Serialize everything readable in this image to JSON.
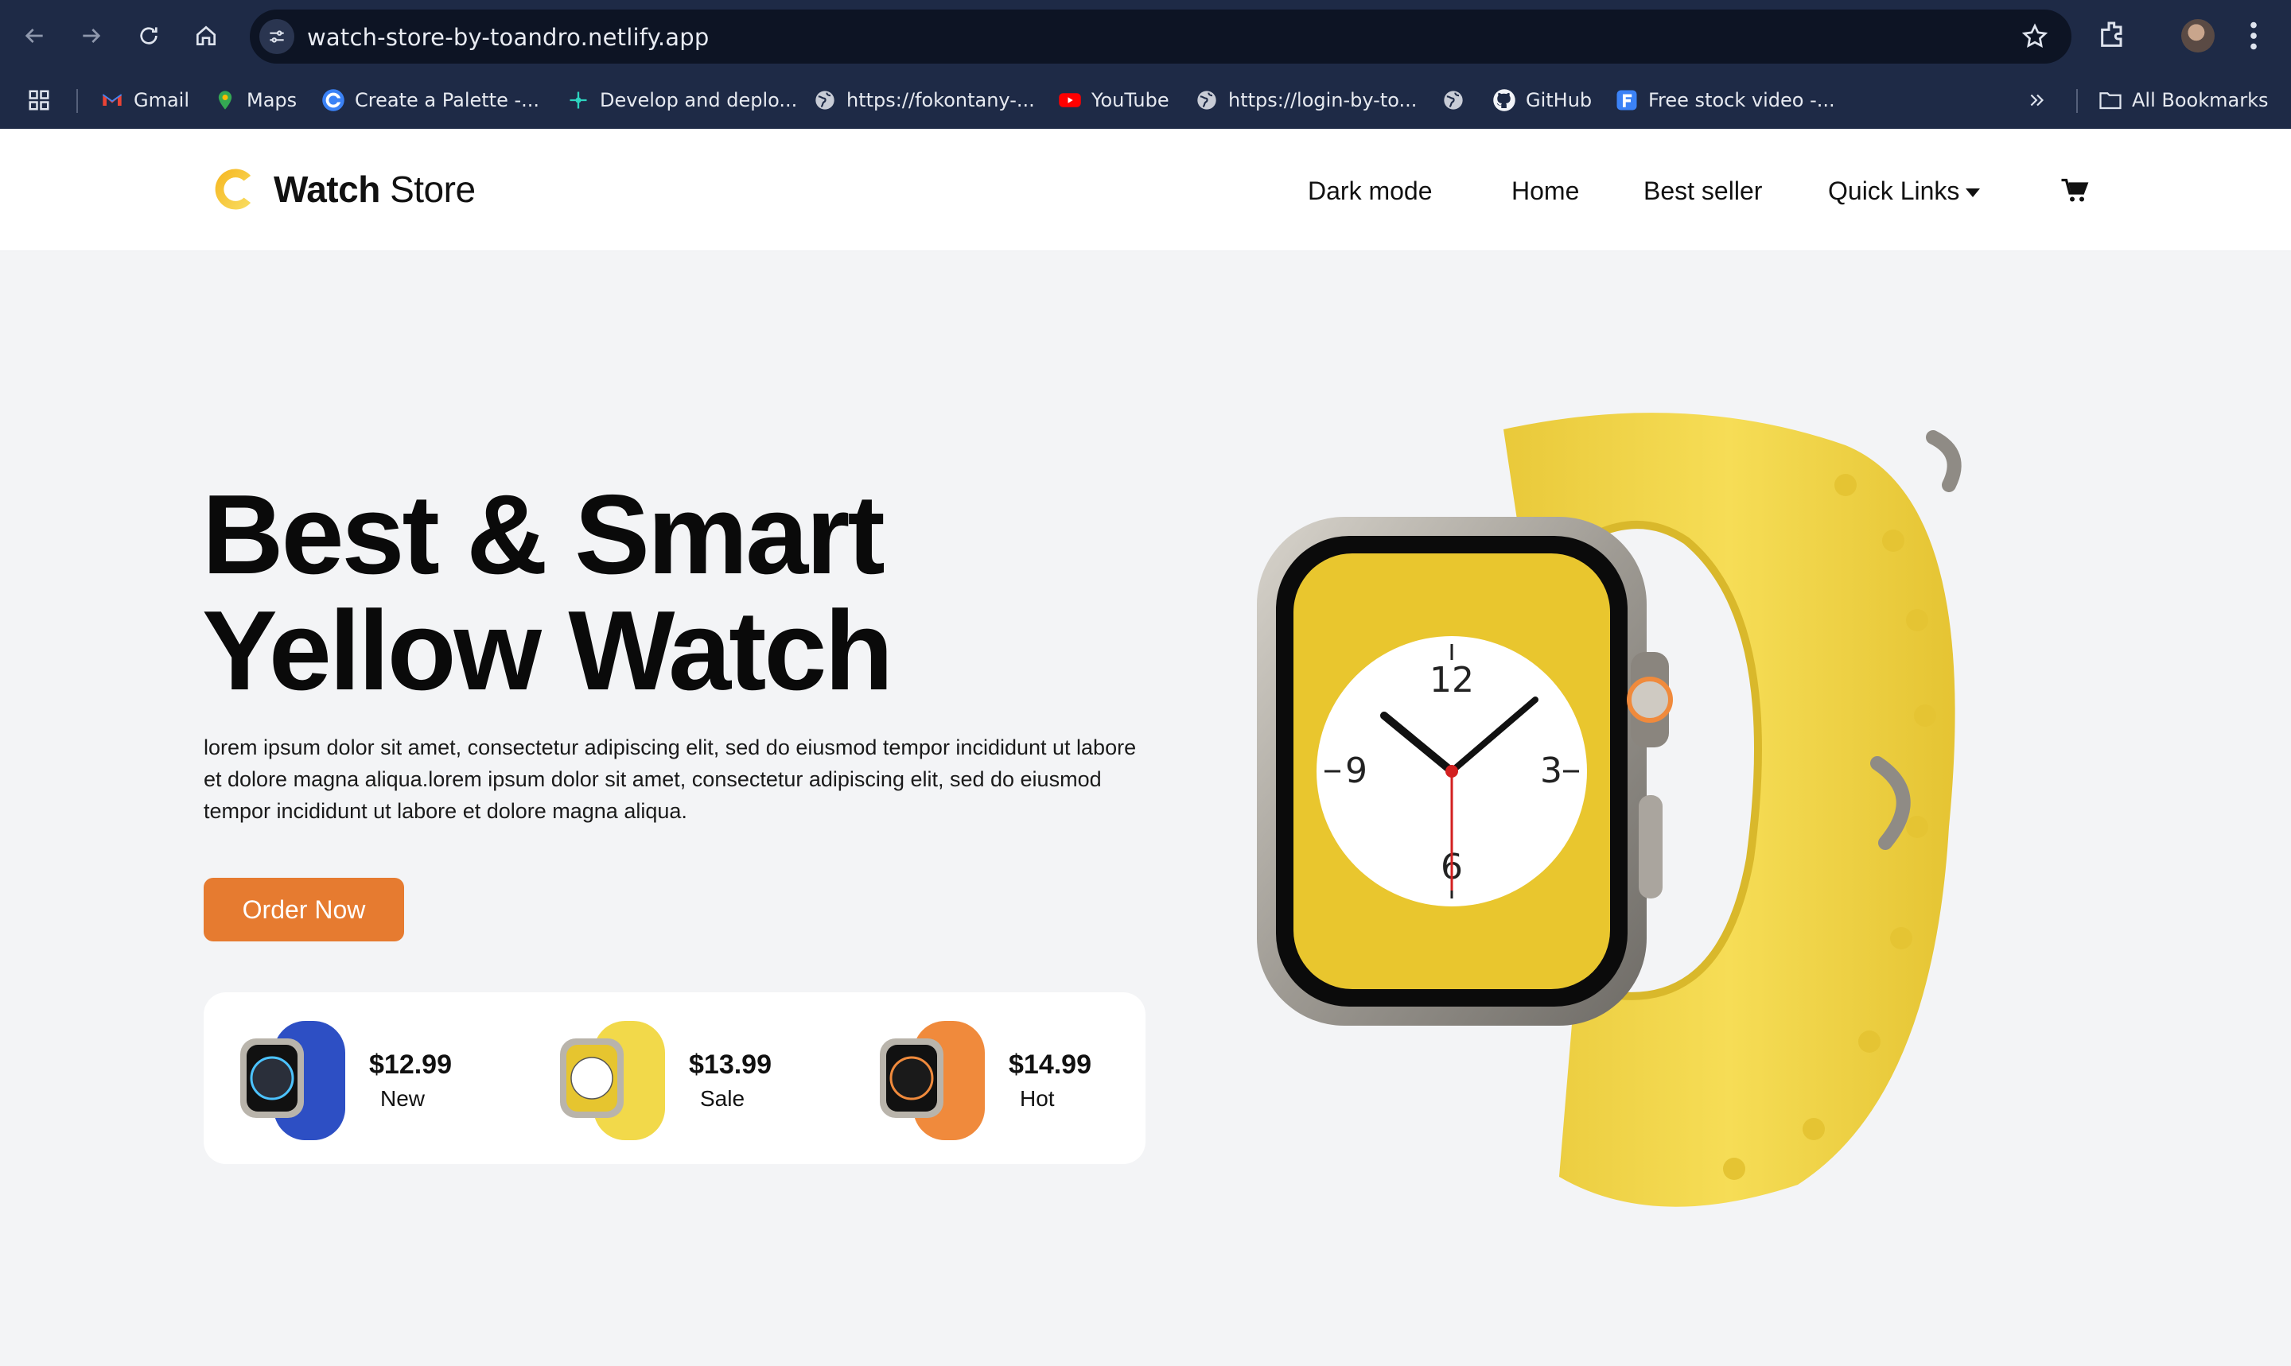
{
  "browser": {
    "url": "watch-store-by-toandro.netlify.app",
    "bookmarks": [
      {
        "label": "Gmail",
        "icon": "gmail-icon"
      },
      {
        "label": "Maps",
        "icon": "maps-icon"
      },
      {
        "label": "Create a Palette -...",
        "icon": "palette-icon"
      },
      {
        "label": "Develop and deplo...",
        "icon": "deploy-icon"
      },
      {
        "label": "https://fokontany-...",
        "icon": "globe-icon"
      },
      {
        "label": "YouTube",
        "icon": "youtube-icon"
      },
      {
        "label": "https://login-by-to...",
        "icon": "globe-icon"
      },
      {
        "label": "",
        "icon": "globe-icon"
      },
      {
        "label": "GitHub",
        "icon": "github-icon"
      },
      {
        "label": "Free stock video -...",
        "icon": "stock-video-icon"
      }
    ],
    "all_bookmarks": "All Bookmarks"
  },
  "site": {
    "logo_bold": "Watch",
    "logo_rest": " Store",
    "nav": {
      "dark_mode": "Dark mode",
      "home": "Home",
      "best_seller": "Best seller",
      "quick_links": "Quick Links"
    }
  },
  "hero": {
    "title_line1": "Best & Smart",
    "title_line2": "Yellow Watch",
    "description": "lorem ipsum dolor sit amet, consectetur adipiscing elit, sed do eiusmod tempor incididunt ut labore et dolore magna aliqua.lorem ipsum dolor sit amet, consectetur adipiscing elit, sed do eiusmod tempor incididunt ut labore et dolore magna aliqua.",
    "order_button": "Order Now"
  },
  "products": [
    {
      "price": "$12.99",
      "tag": "New",
      "color": "#2d4fc4"
    },
    {
      "price": "$13.99",
      "tag": "Sale",
      "color": "#f2d94a"
    },
    {
      "price": "$14.99",
      "tag": "Hot",
      "color": "#f08a3c"
    }
  ],
  "colors": {
    "accent": "#e67b30",
    "watch_band": "#f4da4f",
    "chrome_bg": "#1e2a46"
  }
}
